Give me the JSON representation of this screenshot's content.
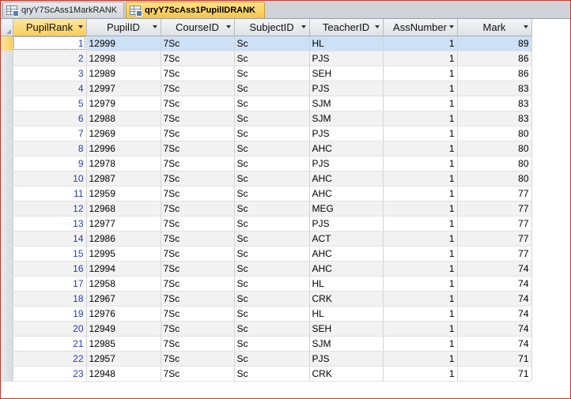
{
  "tabs": [
    {
      "label": "qryY7ScAss1MarkRANK",
      "active": false,
      "icon": "query-icon"
    },
    {
      "label": "qryY7ScAss1PupilIDRANK",
      "active": true,
      "icon": "query-icon"
    }
  ],
  "columns": [
    "PupilRank",
    "PupilID",
    "CourseID",
    "SubjectID",
    "TeacherID",
    "AssNumber",
    "Mark"
  ],
  "rows": [
    [
      "1",
      "12999",
      "7Sc",
      "Sc",
      "HL",
      "1",
      "89"
    ],
    [
      "2",
      "12998",
      "7Sc",
      "Sc",
      "PJS",
      "1",
      "86"
    ],
    [
      "3",
      "12989",
      "7Sc",
      "Sc",
      "SEH",
      "1",
      "86"
    ],
    [
      "4",
      "12997",
      "7Sc",
      "Sc",
      "PJS",
      "1",
      "83"
    ],
    [
      "5",
      "12979",
      "7Sc",
      "Sc",
      "SJM",
      "1",
      "83"
    ],
    [
      "6",
      "12988",
      "7Sc",
      "Sc",
      "SJM",
      "1",
      "83"
    ],
    [
      "7",
      "12969",
      "7Sc",
      "Sc",
      "PJS",
      "1",
      "80"
    ],
    [
      "8",
      "12996",
      "7Sc",
      "Sc",
      "AHC",
      "1",
      "80"
    ],
    [
      "9",
      "12978",
      "7Sc",
      "Sc",
      "PJS",
      "1",
      "80"
    ],
    [
      "10",
      "12987",
      "7Sc",
      "Sc",
      "AHC",
      "1",
      "80"
    ],
    [
      "11",
      "12959",
      "7Sc",
      "Sc",
      "AHC",
      "1",
      "77"
    ],
    [
      "12",
      "12968",
      "7Sc",
      "Sc",
      "MEG",
      "1",
      "77"
    ],
    [
      "13",
      "12977",
      "7Sc",
      "Sc",
      "PJS",
      "1",
      "77"
    ],
    [
      "14",
      "12986",
      "7Sc",
      "Sc",
      "ACT",
      "1",
      "77"
    ],
    [
      "15",
      "12995",
      "7Sc",
      "Sc",
      "AHC",
      "1",
      "77"
    ],
    [
      "16",
      "12994",
      "7Sc",
      "Sc",
      "AHC",
      "1",
      "74"
    ],
    [
      "17",
      "12958",
      "7Sc",
      "Sc",
      "HL",
      "1",
      "74"
    ],
    [
      "18",
      "12967",
      "7Sc",
      "Sc",
      "CRK",
      "1",
      "74"
    ],
    [
      "19",
      "12976",
      "7Sc",
      "Sc",
      "HL",
      "1",
      "74"
    ],
    [
      "20",
      "12949",
      "7Sc",
      "Sc",
      "SEH",
      "1",
      "74"
    ],
    [
      "21",
      "12985",
      "7Sc",
      "Sc",
      "SJM",
      "1",
      "74"
    ],
    [
      "22",
      "12957",
      "7Sc",
      "Sc",
      "PJS",
      "1",
      "71"
    ],
    [
      "23",
      "12948",
      "7Sc",
      "Sc",
      "CRK",
      "1",
      "71"
    ]
  ],
  "colors": {
    "selected_row": "#cde0f5",
    "active_tab": "#f6c54a",
    "rank_text": "#1e3fbf",
    "window_border": "#c0392b"
  }
}
